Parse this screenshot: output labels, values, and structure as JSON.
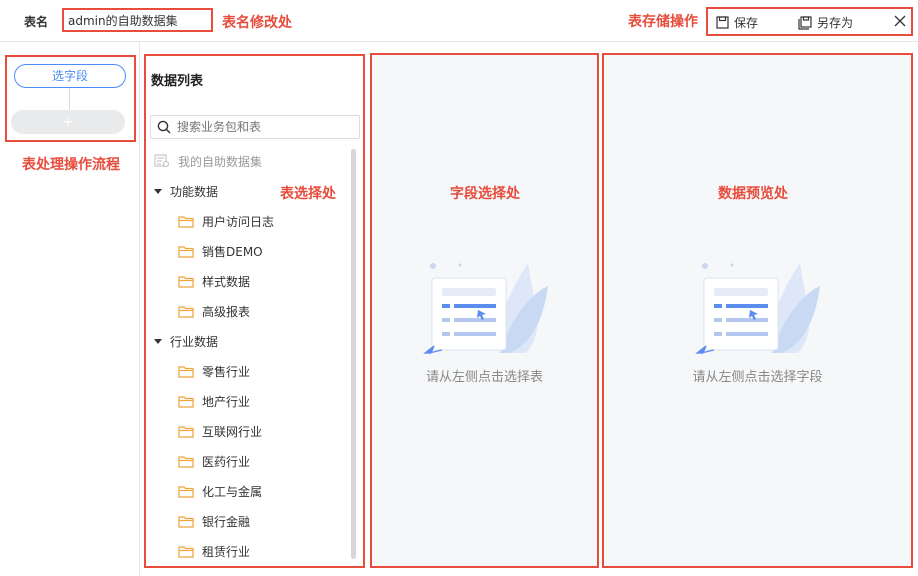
{
  "topbar": {
    "table_name_label": "表名",
    "table_name_value": "admin的自助数据集",
    "save_label": "保存",
    "save_as_label": "另存为"
  },
  "annotations": {
    "rename": "表名修改处",
    "storage": "表存储操作",
    "flow": "表处理操作流程",
    "table_select": "表选择处",
    "field_select": "字段选择处",
    "data_preview": "数据预览处"
  },
  "flow": {
    "step_label": "选字段",
    "add_label": "+"
  },
  "table_list": {
    "title": "数据列表",
    "search_placeholder": "搜索业务包和表",
    "my_dataset": "我的自助数据集",
    "groups": [
      {
        "label": "功能数据",
        "items": [
          "用户访问日志",
          "销售DEMO",
          "样式数据",
          "高级报表"
        ]
      },
      {
        "label": "行业数据",
        "items": [
          "零售行业",
          "地产行业",
          "互联网行业",
          "医药行业",
          "化工与金属",
          "银行金融",
          "租赁行业"
        ]
      }
    ]
  },
  "field_panel": {
    "hint": "请从左侧点击选择表"
  },
  "preview_panel": {
    "hint": "请从左侧点击选择字段"
  },
  "colors": {
    "annotation": "#e74c3c",
    "accent": "#4a8cf7",
    "folder": "#f0a43a",
    "panel_bg": "#f6f7f9"
  }
}
